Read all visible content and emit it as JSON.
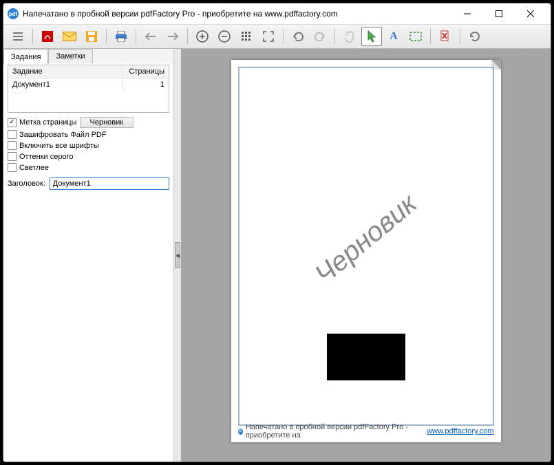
{
  "titlebar": {
    "icon_text": "pdf",
    "title": "Напечатано в пробной версии pdfFactory Pro - приобретите на www.pdffactory.com"
  },
  "toolbar": {
    "menu": "≡",
    "acrobat": "A",
    "email": "✉",
    "save": "💾",
    "print": "🖨",
    "prev": "←",
    "next": "→",
    "zoom_in": "+",
    "zoom_out": "−",
    "thumbs": "⋮⋮⋮",
    "fullscreen": "⛶",
    "undo": "↶",
    "redo": "↷",
    "hand": "✋",
    "pointer": "↖",
    "text": "A",
    "crop": "▭",
    "delete": "✕",
    "refresh": "↻"
  },
  "sidebar": {
    "tabs": [
      {
        "label": "Задания",
        "active": true
      },
      {
        "label": "Заметки",
        "active": false
      }
    ],
    "list": {
      "headers": {
        "job": "Задание",
        "pages": "Страницы"
      },
      "rows": [
        {
          "job": "Документ1",
          "pages": "1"
        }
      ]
    },
    "options": {
      "stamp": {
        "label": "Метка страницы",
        "checked": true,
        "button": "Черновик"
      },
      "encrypt": {
        "label": "Зашифровать Файл PDF",
        "checked": false
      },
      "fonts": {
        "label": "Включить все шрифты",
        "checked": false
      },
      "gray": {
        "label": "Оттенки серого",
        "checked": false
      },
      "light": {
        "label": "Светлее",
        "checked": false
      }
    },
    "title_field": {
      "label": "Заголовок:",
      "value": "Документ1"
    }
  },
  "preview": {
    "watermark": "Черновик",
    "footer_text": "Напечатано в пробной версии pdfFactory Pro - приобретите на ",
    "footer_link": "www.pdffactory.com"
  }
}
